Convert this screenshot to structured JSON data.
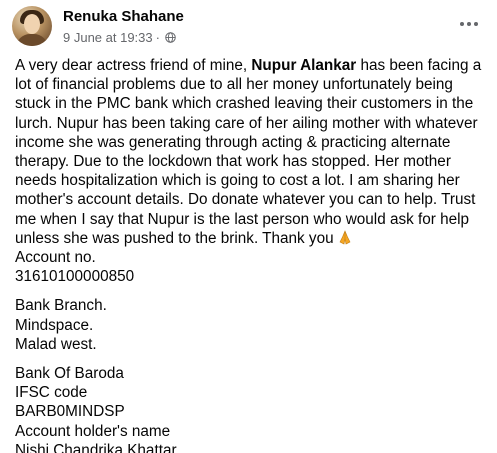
{
  "post": {
    "author": "Renuka Shahane",
    "date": "9 June at 19:33",
    "separator": "·",
    "privacy_icon": "globe-icon",
    "more_icon": "more-options-icon",
    "body_intro": "A very dear actress friend of mine, ",
    "body_name": "Nupur Alankar",
    "body_rest": " has been facing a lot of financial problems due to all her money unfortunately being stuck in the PMC bank which crashed leaving their customers in the lurch. Nupur has been taking care of her ailing mother with whatever income she was generating through acting & practicing alternate therapy. Due to the lockdown that work has stopped. Her mother needs hospitalization which is going to cost a lot. I am sharing her mother's account details. Do donate whatever you can to help. Trust me when I say that Nupur is the last person who would ask for help unless she was pushed to the brink. Thank you",
    "emoji_icon": "folded-hands-icon",
    "account_label": "Account no.",
    "account_number": "31610100000850",
    "branch_label": "Bank Branch.",
    "branch_line1": "Mindspace.",
    "branch_line2": "Malad west.",
    "bank_name": "Bank Of Baroda",
    "ifsc_label": "IFSC code",
    "ifsc_code": "BARB0MINDSP",
    "holder_label": "Account holder's name",
    "holder_name": "Nishi Chandrika Khattar"
  },
  "colors": {
    "text": "#050505",
    "secondary": "#65676b",
    "emoji": "#f5a623"
  }
}
